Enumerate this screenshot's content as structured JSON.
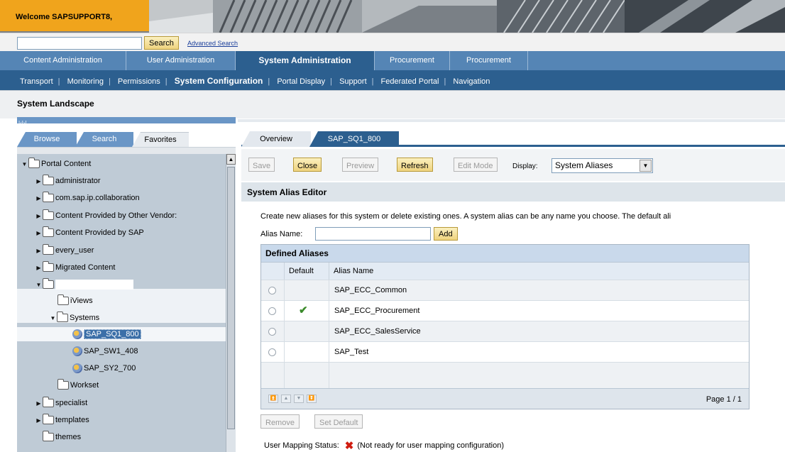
{
  "banner": {
    "welcome": "Welcome SAPSUPPORT8,"
  },
  "search": {
    "value": "",
    "button": "Search",
    "advanced": "Advanced Search"
  },
  "top_nav": [
    "Content Administration",
    "User Administration",
    "System Administration",
    "Procurement",
    "Procurement"
  ],
  "top_nav_active": "System Administration",
  "sub_nav": [
    "Transport",
    "Monitoring",
    "Permissions",
    "System Configuration",
    "Portal Display",
    "Support",
    "Federated Portal",
    "Navigation"
  ],
  "sub_nav_active": "System Configuration",
  "page_title": "System Landscape",
  "collapse_strip": "|‹|›|",
  "left_tabs": [
    "Browse",
    "Search",
    "Favorites"
  ],
  "tree": {
    "root": "Portal Content",
    "items": [
      "administrator",
      "com.sap.ip.collaboration",
      "Content Provided by Other Vendor:",
      "Content Provided by SAP",
      "every_user",
      "Migrated Content"
    ],
    "redacted_folder": "",
    "iviews": "iViews",
    "systems": "Systems",
    "system_items": [
      "SAP_SQ1_800",
      "SAP_SW1_408",
      "SAP_SY2_700"
    ],
    "workset": "Workset",
    "after": [
      "specialist",
      "templates",
      "themes"
    ]
  },
  "right_tabs": [
    "Overview",
    "SAP_SQ1_800"
  ],
  "toolbar": {
    "save": "Save",
    "close": "Close",
    "preview": "Preview",
    "refresh": "Refresh",
    "edit_mode": "Edit Mode",
    "display_label": "Display:",
    "display_value": "System Aliases"
  },
  "editor": {
    "title": "System Alias Editor",
    "description": "Create new aliases for this system or delete existing ones. A system alias can be any name you choose. The default ali",
    "alias_label": "Alias Name:",
    "alias_value": "",
    "add_button": "Add"
  },
  "table": {
    "title": "Defined Aliases",
    "headers": [
      "",
      "Default",
      "Alias Name"
    ],
    "rows": [
      {
        "alias": "SAP_ECC_Common",
        "default": false
      },
      {
        "alias": "SAP_ECC_Procurement",
        "default": true
      },
      {
        "alias": "SAP_ECC_SalesService",
        "default": false
      },
      {
        "alias": "SAP_Test",
        "default": false
      }
    ],
    "page": "Page 1 / 1"
  },
  "actions": {
    "remove": "Remove",
    "set_default": "Set Default"
  },
  "status": {
    "label": "User Mapping Status:",
    "text": "(Not ready for user mapping configuration)"
  },
  "colors": {
    "accent_nav": "#5585b5",
    "nav_dark": "#2c5f8f",
    "welcome": "#f0a41c",
    "button_yellow": "#efd37e"
  }
}
